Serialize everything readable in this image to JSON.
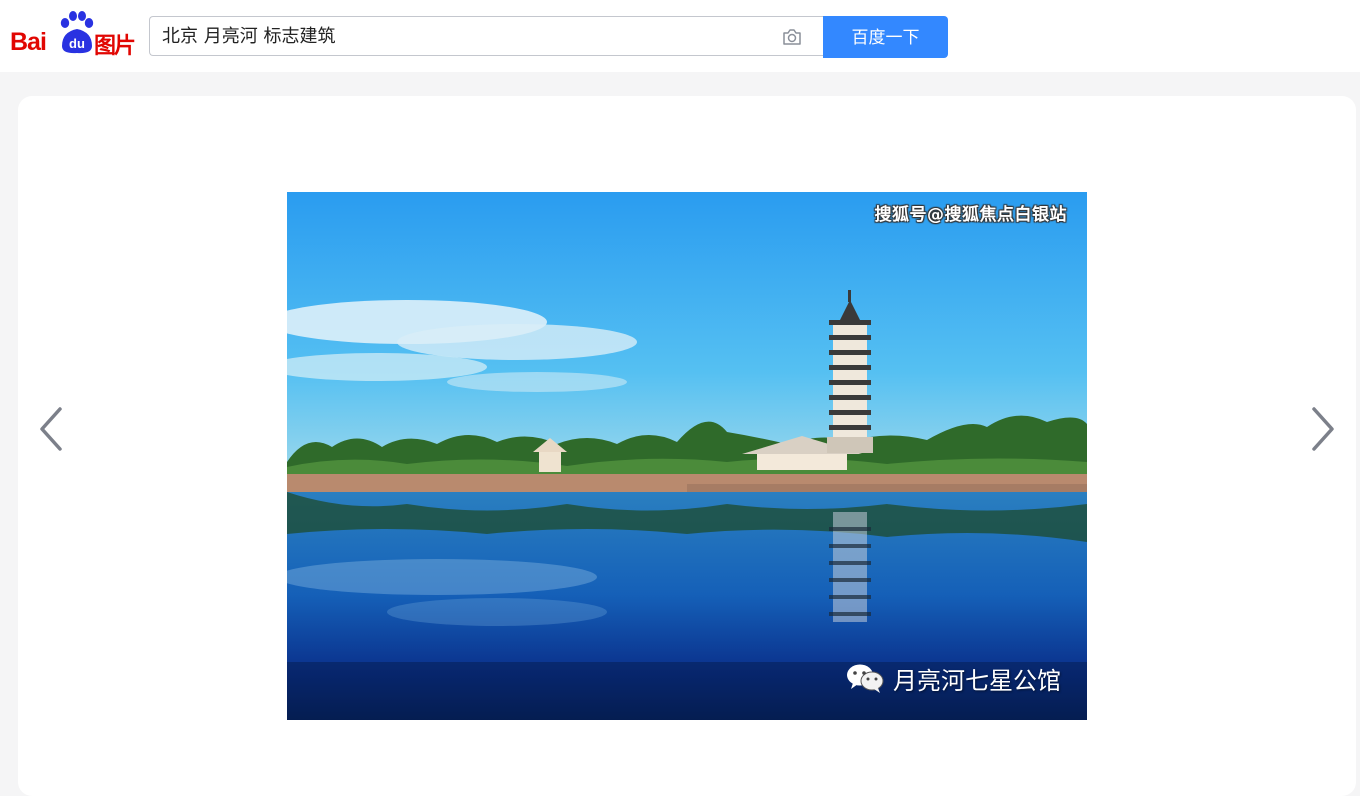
{
  "header": {
    "logo": {
      "brand": "Bai",
      "paw_text": "du",
      "product": "图片"
    },
    "search": {
      "value": "北京 月亮河 标志建筑",
      "placeholder": ""
    },
    "search_button_label": "百度一下",
    "icons": {
      "camera": "camera-icon"
    }
  },
  "viewer": {
    "prev_icon": "chevron-left-icon",
    "next_icon": "chevron-right-icon",
    "image": {
      "watermark_top": "搜狐号@搜狐焦点白银站",
      "watermark_bottom": "月亮河七星公馆",
      "watermark_icon": "wechat-icon"
    }
  },
  "colors": {
    "brand_red": "#e10602",
    "paw_blue": "#2932e1",
    "button_blue": "#3388ff"
  }
}
